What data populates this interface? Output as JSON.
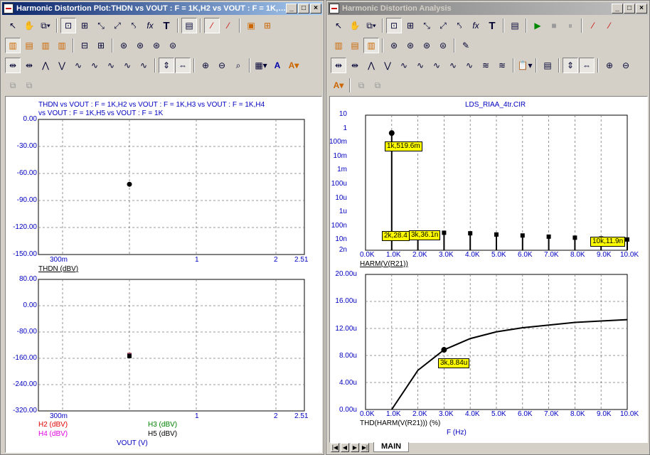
{
  "left_window": {
    "title": "Harmonic Distortion Plot:THDN vs VOUT : F = 1K,H2 vs VOUT : F = 1K,H3 vs VOUT : F = ...",
    "legend_line1": "THDN vs VOUT : F = 1K,H2 vs VOUT : F = 1K,H3 vs VOUT : F = 1K,H4",
    "legend_line2": "vs VOUT : F = 1K,H5 vs VOUT : F = 1K",
    "top_plot": {
      "ylabels": [
        "0.00",
        "-30.00",
        "-60.00",
        "-90.00",
        "-120.00",
        "-150.00"
      ],
      "xlabels": [
        "300m",
        "1",
        "2",
        "2.51"
      ],
      "trace_label": "THDN (dBV)"
    },
    "bottom_plot": {
      "ylabels": [
        "80.00",
        "0.00",
        "-80.00",
        "-160.00",
        "-240.00",
        "-320.00"
      ],
      "xlabels": [
        "300m",
        "1",
        "2",
        "2.51"
      ],
      "traces": {
        "h2": "H2 (dBV)",
        "h3": "H3 (dBV)",
        "h4": "H4 (dBV)",
        "h5": "H5 (dBV)"
      },
      "x_axis_label": "VOUT (V)"
    }
  },
  "right_window": {
    "title": "Harmonic Distortion Analysis",
    "plot_title": "LDS_RIAA_4tr.CIR",
    "top_plot": {
      "ylabels": [
        "10",
        "1",
        "100m",
        "10m",
        "1m",
        "100u",
        "10u",
        "1u",
        "100n",
        "10n",
        "2n"
      ],
      "xlabels": [
        "0.0K",
        "1.0K",
        "2.0K",
        "3.0K",
        "4.0K",
        "5.0K",
        "6.0K",
        "7.0K",
        "8.0K",
        "9.0K",
        "10.0K"
      ],
      "trace_label": "HARM(V(R21))",
      "tags": {
        "t1": "1k,519.6m",
        "t2": "2k,28.4",
        "t3": "3k,36.1n",
        "t4": "10k,11.9n"
      }
    },
    "bottom_plot": {
      "ylabels": [
        "20.00u",
        "16.00u",
        "12.00u",
        "8.00u",
        "4.00u",
        "0.00u"
      ],
      "xlabels": [
        "0.0K",
        "1.0K",
        "2.0K",
        "3.0K",
        "4.0K",
        "5.0K",
        "6.0K",
        "7.0K",
        "8.0K",
        "9.0K",
        "10.0K"
      ],
      "trace_label": "THD(HARM(V(R21))) (%)",
      "x_axis_label": "F (Hz)",
      "tag": "3k,8.84u"
    },
    "tab": "MAIN"
  },
  "chart_data": [
    {
      "type": "scatter",
      "title": "",
      "xlabel": "",
      "ylabel": "THDN (dBV)",
      "xlim": [
        0.2,
        2.51
      ],
      "ylim": [
        -150,
        0
      ],
      "series": [
        {
          "name": "THDN (dBV)",
          "x": [
            0.65
          ],
          "y": [
            -72
          ]
        }
      ]
    },
    {
      "type": "scatter",
      "title": "",
      "xlabel": "VOUT (V)",
      "ylabel": "",
      "xlim": [
        0.2,
        2.51
      ],
      "ylim": [
        -320,
        80
      ],
      "series": [
        {
          "name": "H2 (dBV)",
          "x": [
            0.65
          ],
          "y": [
            -150
          ]
        },
        {
          "name": "H3 (dBV)",
          "x": [
            0.65
          ],
          "y": [
            -151
          ]
        },
        {
          "name": "H4 (dBV)",
          "x": [
            0.65
          ],
          "y": [
            -152
          ]
        },
        {
          "name": "H5 (dBV)",
          "x": [
            0.65
          ],
          "y": [
            -153
          ]
        }
      ]
    },
    {
      "type": "bar",
      "title": "LDS_RIAA_4tr.CIR",
      "xlabel": "",
      "ylabel": "HARM(V(R21))",
      "y_scale": "log",
      "xlim": [
        0,
        10000
      ],
      "ylim": [
        2e-09,
        10
      ],
      "x": [
        1000,
        2000,
        3000,
        4000,
        5000,
        6000,
        7000,
        8000,
        9000,
        10000
      ],
      "values": [
        0.5196,
        2.84e-08,
        3.61e-08,
        3.3e-08,
        2.7e-08,
        2.3e-08,
        1.9e-08,
        1.6e-08,
        1.4e-08,
        1.19e-08
      ]
    },
    {
      "type": "line",
      "title": "",
      "xlabel": "F (Hz)",
      "ylabel": "THD(HARM(V(R21))) (%)",
      "xlim": [
        0,
        10000
      ],
      "ylim": [
        0,
        2e-05
      ],
      "series": [
        {
          "name": "THD(HARM(V(R21))) (%)",
          "x": [
            1000,
            2000,
            3000,
            4000,
            5000,
            6000,
            7000,
            8000,
            9000,
            10000
          ],
          "y": [
            0,
            5.8e-06,
            8.84e-06,
            1.05e-05,
            1.15e-05,
            1.21e-05,
            1.25e-05,
            1.29e-05,
            1.31e-05,
            1.33e-05
          ]
        }
      ]
    }
  ]
}
